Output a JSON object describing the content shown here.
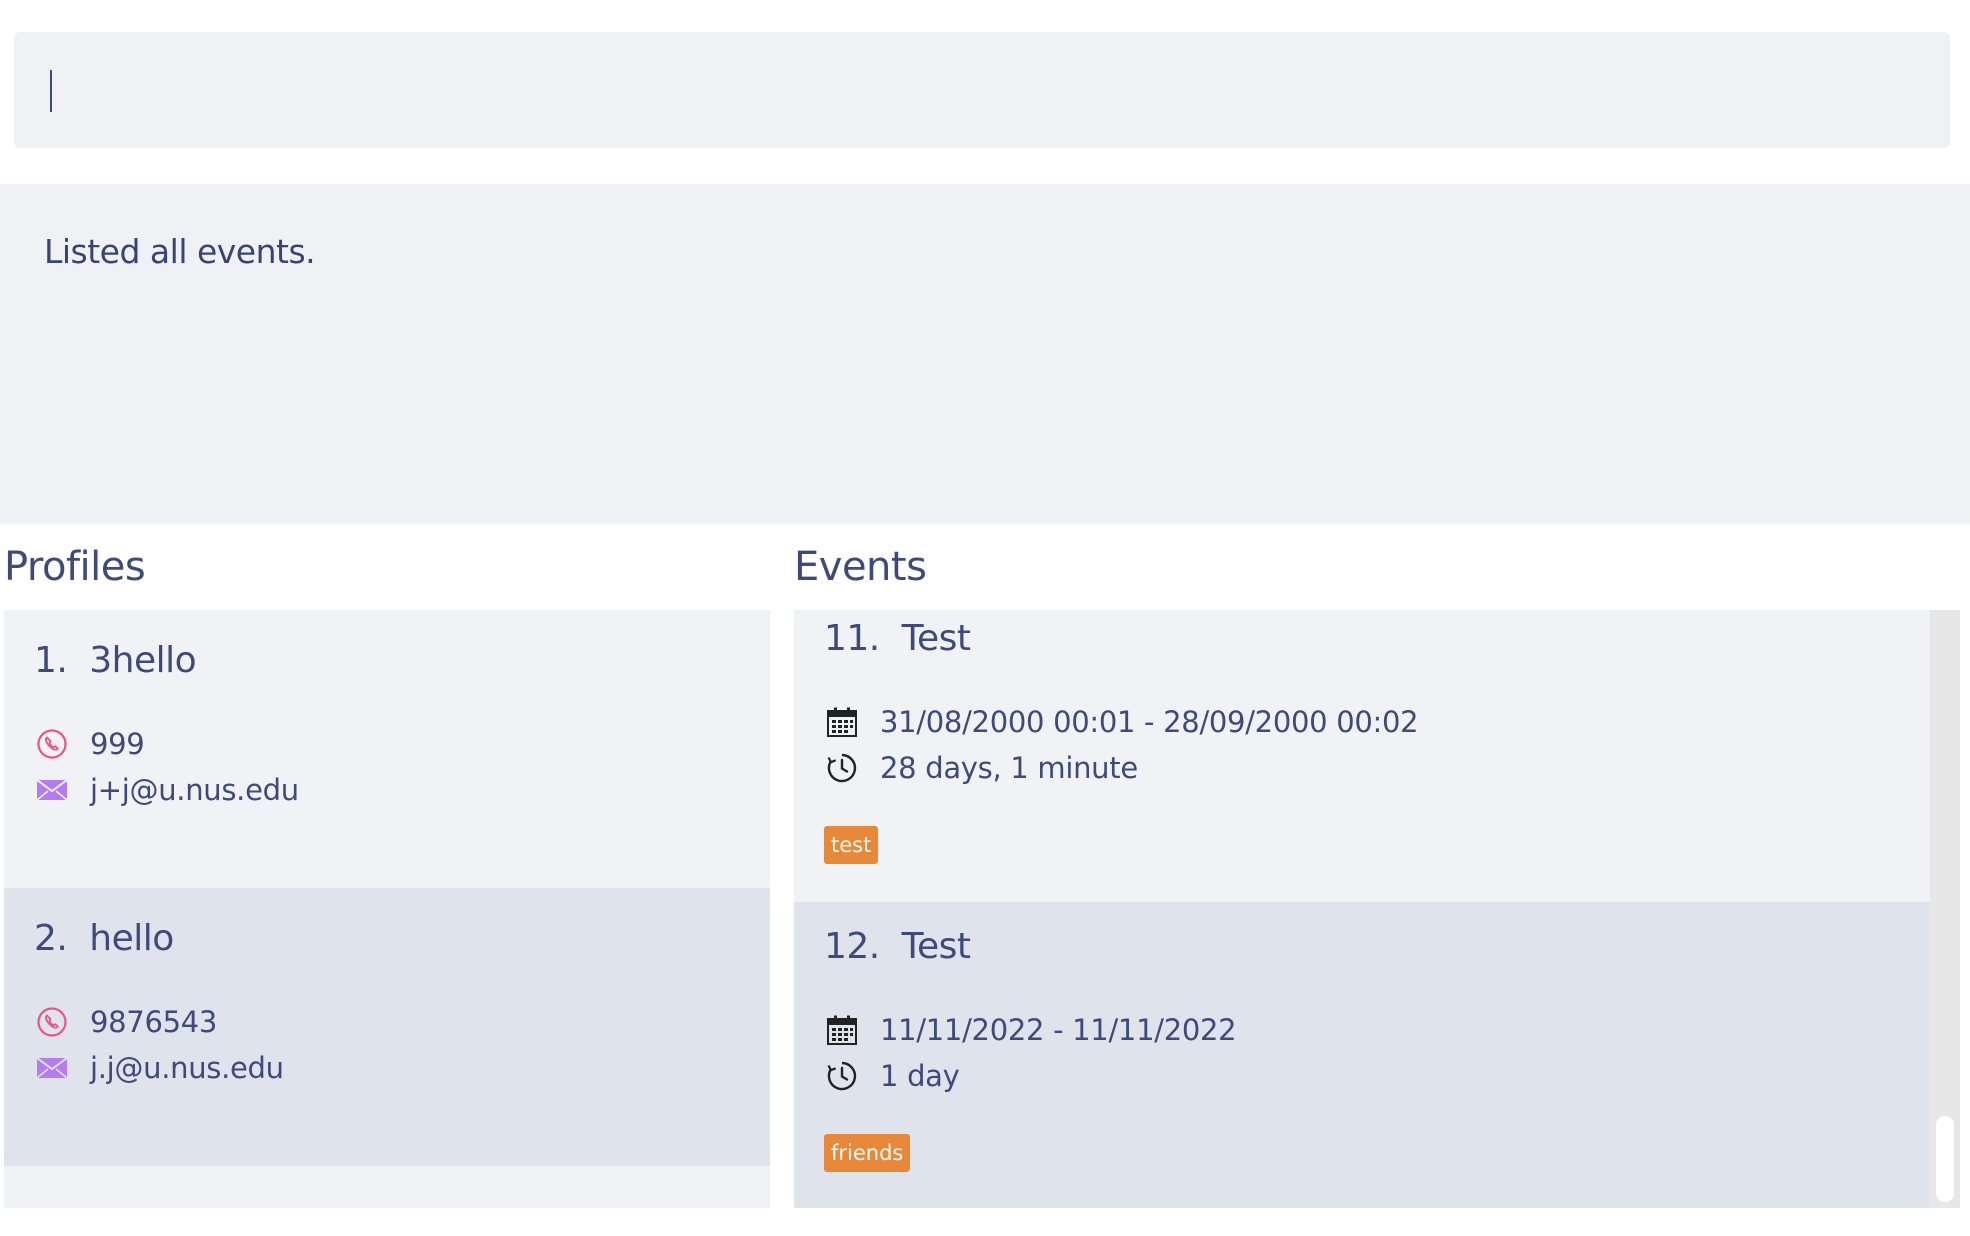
{
  "command": {
    "value": "",
    "placeholder": ""
  },
  "result": {
    "message": "Listed all events."
  },
  "profiles": {
    "title": "Profiles",
    "items": [
      {
        "index": "1.",
        "name": "3hello",
        "phone": "999",
        "email": "j+j@u.nus.edu"
      },
      {
        "index": "2.",
        "name": "hello",
        "phone": "9876543",
        "email": "j.j@u.nus.edu"
      }
    ]
  },
  "events": {
    "title": "Events",
    "items": [
      {
        "index": "11.",
        "name": "Test",
        "range": "31/08/2000 00:01 - 28/09/2000 00:02",
        "duration": "28 days, 1 minute",
        "tag": "test"
      },
      {
        "index": "12.",
        "name": "Test",
        "range": "11/11/2022 - 11/11/2022",
        "duration": "1 day",
        "tag": "friends"
      }
    ]
  },
  "icons": {
    "phone": "phone-icon",
    "email": "email-icon",
    "calendar": "calendar-icon",
    "duration": "clock-icon"
  },
  "colors": {
    "background_panel": "#f0f1f5",
    "card_alt": "#dfe3eb",
    "text": "#3f4a7a",
    "tag": "#e8893a",
    "phone_icon": "#e8577f",
    "email_icon": "#b47cf0"
  }
}
